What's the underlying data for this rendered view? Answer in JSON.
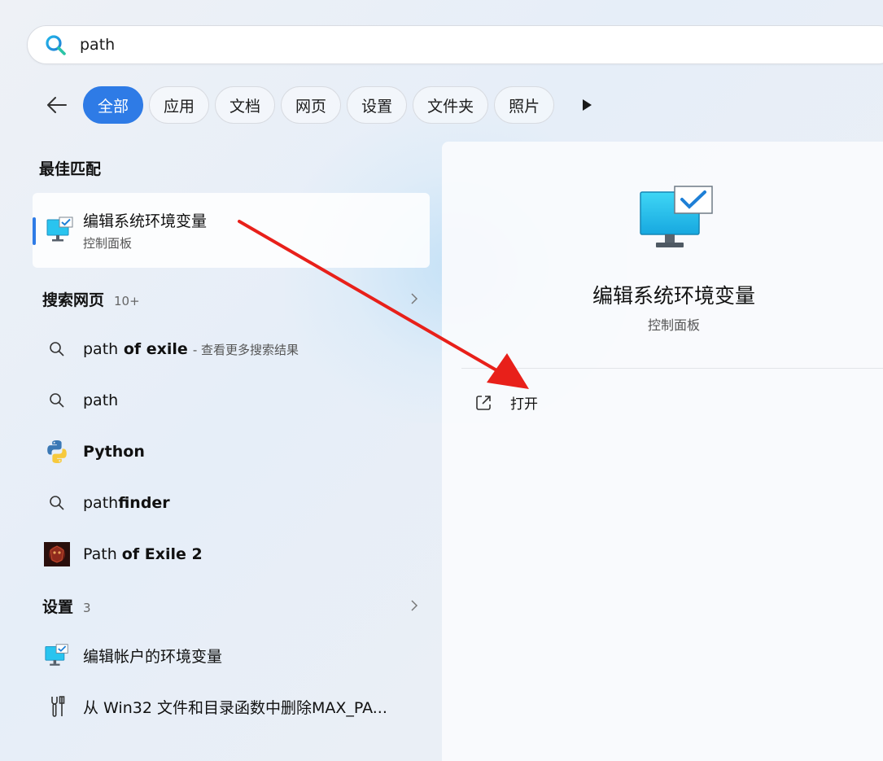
{
  "search": {
    "value": "path"
  },
  "filters": [
    "全部",
    "应用",
    "文档",
    "网页",
    "设置",
    "文件夹",
    "照片"
  ],
  "best_match": {
    "heading": "最佳匹配",
    "title": "编辑系统环境变量",
    "subtitle": "控制面板"
  },
  "web": {
    "heading": "搜索网页",
    "count": "10+",
    "items": [
      {
        "pre": "path",
        "bold": " of exile",
        "sub": "- 查看更多搜索结果"
      },
      {
        "pre": "path",
        "bold": "",
        "sub": ""
      }
    ]
  },
  "apps": [
    {
      "label": "Python",
      "icon": "python-icon"
    },
    {
      "pre": "path",
      "bold": "finder",
      "icon": "search-icon"
    },
    {
      "pre": "Path ",
      "bold": "of Exile 2",
      "icon": "poe2-icon"
    }
  ],
  "settings": {
    "heading": "设置",
    "count": "3",
    "items": [
      {
        "label": "编辑帐户的环境变量",
        "icon": "monitor-check-icon"
      },
      {
        "label": "从 Win32 文件和目录函数中删除MAX_PA...",
        "icon": "wrench-icon"
      }
    ]
  },
  "detail": {
    "title": "编辑系统环境变量",
    "subtitle": "控制面板",
    "action": "打开"
  },
  "colors": {
    "accent": "#2e7be6",
    "annotation_arrow": "#e8201a"
  }
}
